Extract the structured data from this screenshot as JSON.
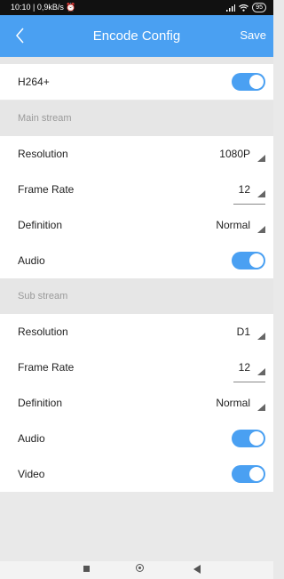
{
  "status_bar": {
    "time_speed": "10:10 | 0,9kB/s",
    "alarm_icon": "alarm-clock-icon",
    "signal_icon": "signal-bars-icon",
    "wifi_icon": "wifi-icon",
    "battery": "95"
  },
  "app_bar": {
    "title": "Encode Config",
    "back_icon": "chevron-left-icon",
    "save_label": "Save",
    "color": "#4aa0f2"
  },
  "settings": {
    "h264_label": "H264+",
    "h264_on": true,
    "main": {
      "header": "Main stream",
      "resolution_label": "Resolution",
      "resolution_value": "1080P",
      "frame_rate_label": "Frame Rate",
      "frame_rate_value": "12",
      "definition_label": "Definition",
      "definition_value": "Normal",
      "audio_label": "Audio",
      "audio_on": true
    },
    "sub": {
      "header": "Sub stream",
      "resolution_label": "Resolution",
      "resolution_value": "D1",
      "frame_rate_label": "Frame Rate",
      "frame_rate_value": "12",
      "definition_label": "Definition",
      "definition_value": "Normal",
      "audio_label": "Audio",
      "audio_on": true,
      "video_label": "Video",
      "video_on": true
    }
  },
  "nav_bar": {
    "recents_icon": "square-recents-icon",
    "home_icon": "circle-home-icon",
    "back_icon": "triangle-back-icon"
  }
}
